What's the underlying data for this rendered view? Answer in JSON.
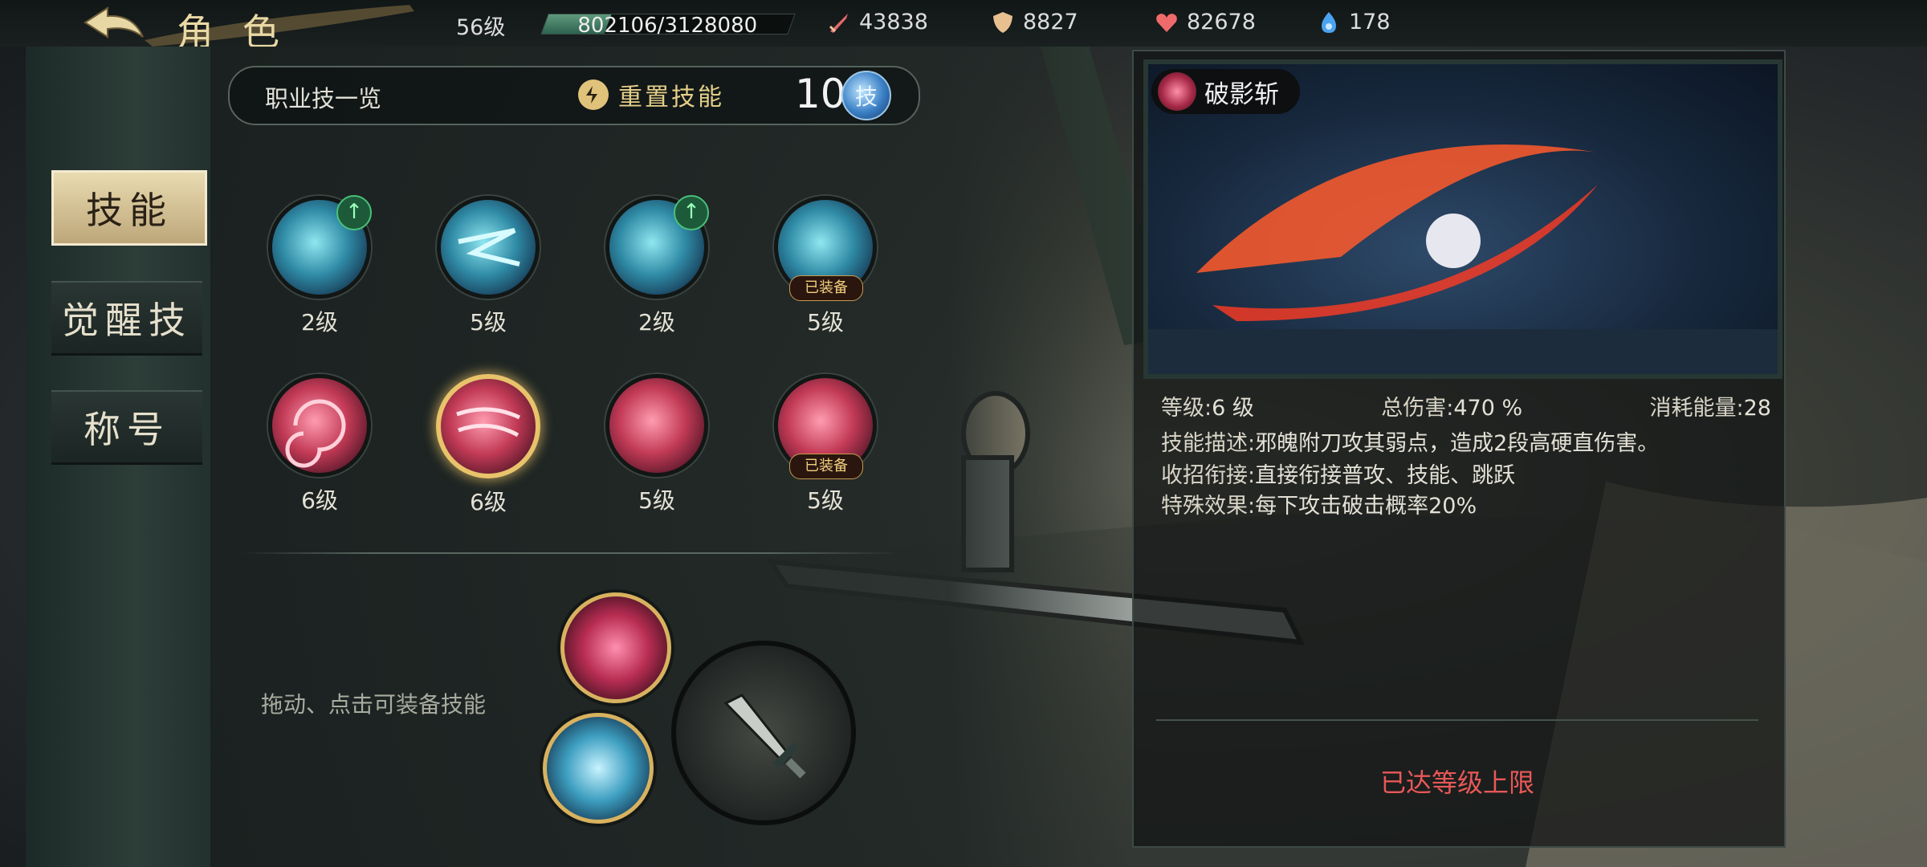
{
  "header": {
    "title": "角色",
    "level": "56级",
    "exp": "802106/3128080",
    "exp_progress": 0.256,
    "attack": "43838",
    "defense": "8827",
    "hp": "82678",
    "energy": "178"
  },
  "sidebar": {
    "tabs": [
      {
        "label": "技能",
        "active": true
      },
      {
        "label": "觉醒技",
        "active": false
      },
      {
        "label": "称号",
        "active": false
      }
    ]
  },
  "skills": {
    "header_label": "职业技一览",
    "reset_label": "重置技能",
    "points": "10",
    "points_glyph": "技",
    "equipped_badge": "已装备",
    "list": [
      {
        "level": "2级",
        "color": "blue",
        "upgrade": true
      },
      {
        "level": "5级",
        "color": "blue"
      },
      {
        "level": "2级",
        "color": "blue",
        "upgrade": true
      },
      {
        "level": "5级",
        "color": "blue",
        "equipped": true
      },
      {
        "level": "6级",
        "color": "red"
      },
      {
        "level": "6级",
        "color": "red",
        "selected": true
      },
      {
        "level": "5级",
        "color": "red"
      },
      {
        "level": "5级",
        "color": "red",
        "equipped": true
      }
    ],
    "drag_hint": "拖动、点击可装备技能"
  },
  "detail": {
    "skill_name": "破影斩",
    "level_label": "等级:",
    "level_value": "6 级",
    "damage_label": "总伤害:",
    "damage_value": "470 %",
    "cost_label": "消耗能量:",
    "cost_value": "28",
    "desc_label": "技能描述:",
    "desc_value": "邪魄附刀攻其弱点，造成2段高硬直伤害。",
    "combo_label": "收招衔接:",
    "combo_value": "直接衔接普攻、技能、跳跃",
    "effect_label": "特殊效果:",
    "effect_value": "每下攻击破击概率20%",
    "max_level_text": "已达等级上限"
  },
  "colors": {
    "accent_gold": "#e8c36b",
    "warning_red": "#e85858",
    "upgrade_green": "#4ac07a"
  }
}
